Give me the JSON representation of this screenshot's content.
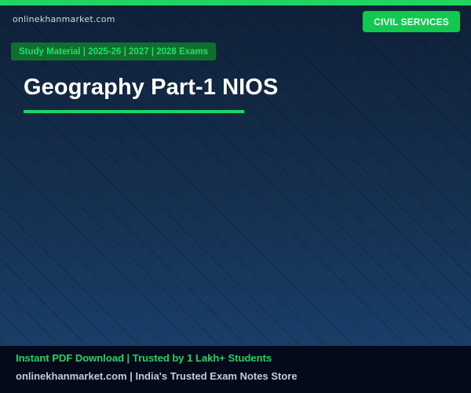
{
  "header": {
    "site_name": "onlinekhanmarket.com",
    "category_label": "CIVIL SERVICES",
    "tagline": "Study Material | 2025-26 | 2027 | 2028 Exams"
  },
  "main": {
    "title": "Geography Part-1 NIOS"
  },
  "footer": {
    "line1": "Instant PDF Download | Trusted by 1 Lakh+ Students",
    "line2": "onlinekhanmarket.com | India's Trusted Exam Notes Store"
  },
  "colors": {
    "accent": "#1ed65f",
    "background_top": "#0f2038",
    "background_bottom": "#1a4270",
    "footer_background": "#050a1a"
  }
}
